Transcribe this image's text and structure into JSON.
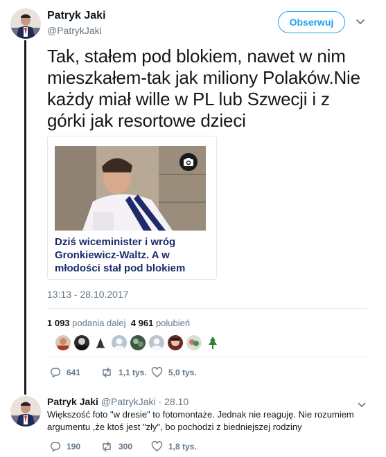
{
  "tweet": {
    "author_name": "Patryk Jaki",
    "author_handle": "@PatrykJaki",
    "follow_label": "Obserwuj",
    "text": "Tak, stałem pod blokiem, nawet w nim mieszkałem-tak jak miliony Polaków.Nie każdy miał wille w PL lub Szwecji i z górki jak resortowe dzieci",
    "card_title": "Dziś wiceminister i wróg Gronkiewicz-Waltz. A w młodości stał pod blokiem",
    "timestamp": "13:13 - 28.10.2017",
    "retweets_count": "1 093",
    "retweets_label": "podania dalej",
    "likes_count": "4 961",
    "likes_label": "polubień",
    "actions": {
      "replies": "641",
      "retweets": "1,1 tys.",
      "likes": "5,0 tys."
    }
  },
  "reply": {
    "author_name": "Patryk Jaki",
    "author_handle": "@PatrykJaki · 28.10",
    "text": "Większość foto \"w dresie\" to fotomontaże. Jednak nie reaguję. Nie rozumiem argumentu ,że ktoś jest \"zły\", bo pochodzi z biedniejszej rodziny",
    "actions": {
      "replies": "190",
      "retweets": "300",
      "likes": "1,8 tys."
    }
  },
  "colors": {
    "accent": "#1da1f2",
    "secondary_text": "#657786",
    "card_title": "#1c2b6b"
  },
  "icons": [
    "chevron-down-icon",
    "camera-icon",
    "reply-icon",
    "retweet-icon",
    "like-icon"
  ]
}
